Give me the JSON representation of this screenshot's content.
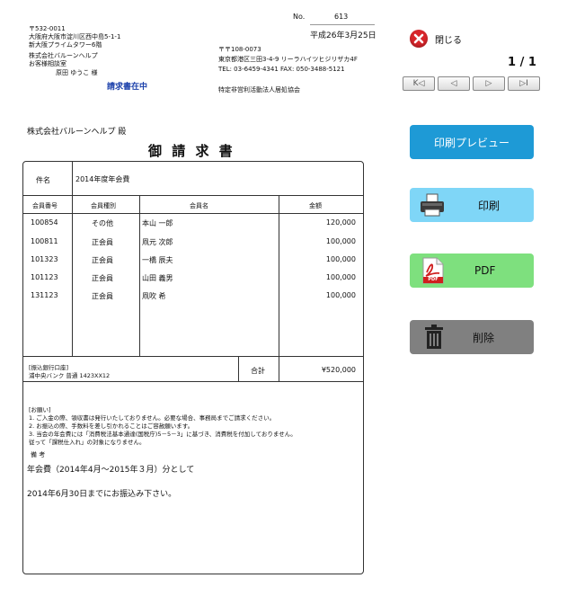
{
  "header": {
    "number_label": "No.",
    "number_value": "613",
    "date": "平成26年3月25日",
    "recipient_zip": "〒532-0011",
    "recipient_addr1": "大阪府大阪市淀川区西中島5-1-1",
    "recipient_addr2": "新大阪プライムタワー6階",
    "recipient_company": "株式会社バルーンヘルプ",
    "recipient_dept": "お客様相談室",
    "recipient_person": "原田 ゆうこ 様",
    "status_label": "請求書在中",
    "sender_zip": "〒〒108-0073",
    "sender_addr": "東京都港区三田3-4-9 リーラハイツヒジリザカ4F",
    "sender_tel": "TEL: 03-6459-4341  FAX: 050-3488-5121",
    "sender_org": "特定非営利活動法人居処協会"
  },
  "doc": {
    "billto": "株式会社バルーンヘルプ 殿",
    "title": "御 請 求 書",
    "subject_label": "件名",
    "subject_value": "2014年度年会費",
    "columns": [
      "会員番号",
      "会員種別",
      "会員名",
      "金額"
    ],
    "rows": [
      {
        "id": "100854",
        "type": "その他",
        "name": "本山 一郎",
        "amount": "120,000"
      },
      {
        "id": "100811",
        "type": "正会員",
        "name": "凧元 次郎",
        "amount": "100,000"
      },
      {
        "id": "101323",
        "type": "正会員",
        "name": "一橋 辰夫",
        "amount": "100,000"
      },
      {
        "id": "101123",
        "type": "正会員",
        "name": "山田 義男",
        "amount": "100,000"
      },
      {
        "id": "131123",
        "type": "正会員",
        "name": "凧吹 希",
        "amount": "100,000"
      }
    ],
    "bank_label": "[振込銀行口座]",
    "bank_value": "浦中央バンク 普通 1423XX12",
    "total_label": "合計",
    "total_value": "¥520,000",
    "notes_title": "[お願い]",
    "notes": [
      "1. ご入金の際、領収書は発行いたしておりません。必要な場合、事務局までご請求ください。",
      "2. お振込の際、手数料を差し引かれることはご容赦願います。",
      "3. 当会の年会費には「消費税法基本通達(国税庁)5－5－3」に基づき、消費税を付加しておりません。",
      "   従って「課税仕入れ」の対象になりません。"
    ],
    "remarks_label": "備 考",
    "remarks_line1": "年会費（2014年4月～2015年３月）分として",
    "remarks_line2": "2014年6月30日までにお振込み下さい。"
  },
  "panel": {
    "close_label": "閉じる",
    "page_indicator": "1 / 1",
    "pager_first": "K◁",
    "pager_prev": "◁",
    "pager_next": "▷",
    "pager_last": "▷I",
    "preview_label": "印刷プレビュー",
    "print_label": "印刷",
    "pdf_label": "PDF",
    "pdf_badge": "PDF",
    "delete_label": "削除",
    "colors": {
      "preview_bg": "#1e9ad6",
      "print_bg": "#7fd6f7",
      "pdf_bg": "#7ee07e",
      "delete_bg": "#808080",
      "close_red": "#d8262b"
    }
  }
}
